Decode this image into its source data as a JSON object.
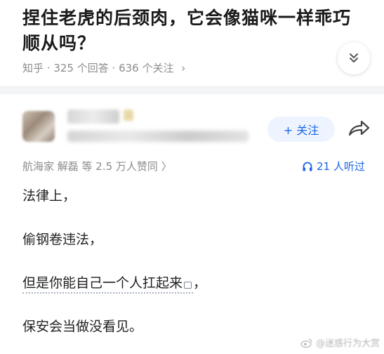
{
  "question": {
    "title": "捏住老虎的后颈肉，它会像猫咪一样乖巧顺从吗？",
    "source": "知乎",
    "answers": "325 个回答",
    "followers": "636 个关注",
    "meta_chevron": "›"
  },
  "author": {
    "follow_label": "+ 关注"
  },
  "answer": {
    "upvote_line": "航海家 解磊 等 2.5 万人赞同 〉",
    "listen_count": "21 人听过",
    "lines": [
      "法律上，",
      "偷钢卷违法，",
      "但是你能自己一个人扛起来",
      "保安会当做没看见。"
    ],
    "line3_suffix": "，"
  },
  "watermark": {
    "text": "@迷惑行为大赏"
  },
  "colors": {
    "accent": "#1966e6",
    "meta_gray": "#8c8c8c",
    "divider": "#f3f4f6"
  }
}
